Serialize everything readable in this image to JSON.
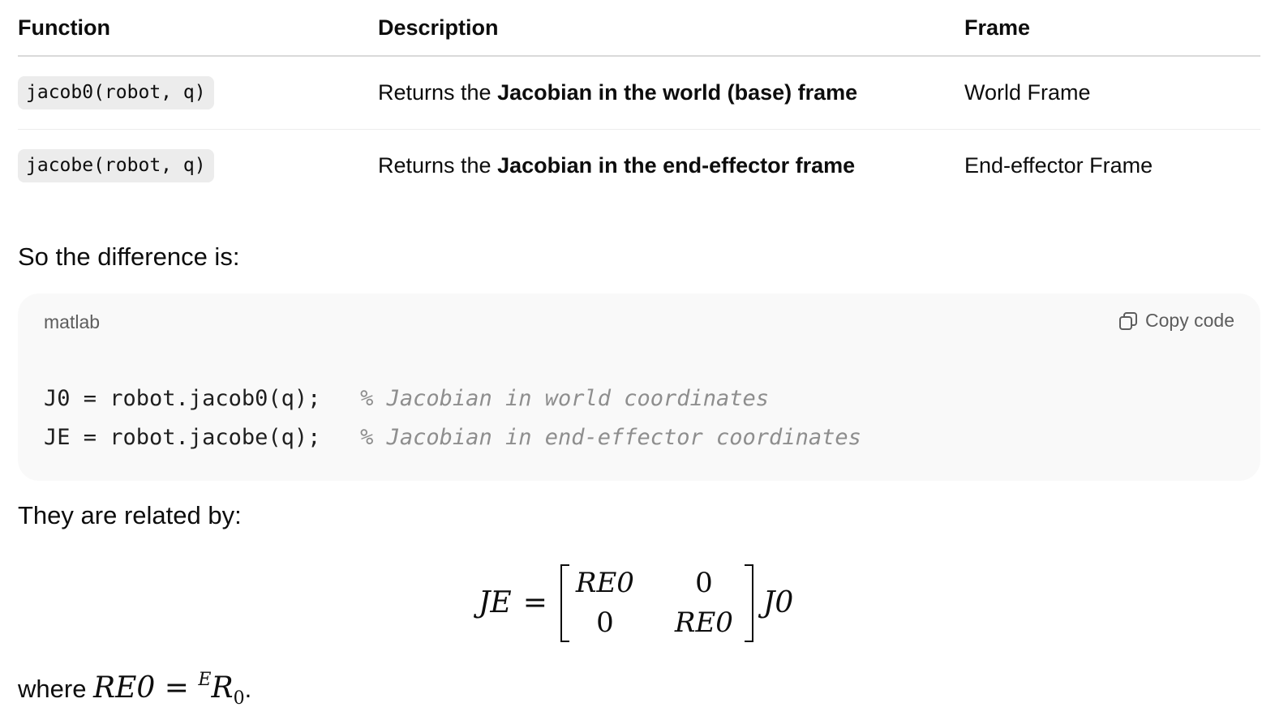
{
  "table": {
    "headers": [
      "Function",
      "Description",
      "Frame"
    ],
    "rows": [
      {
        "function": "jacob0(robot, q)",
        "desc_prefix": "Returns the ",
        "desc_bold": "Jacobian in the world (base) frame",
        "frame": "World Frame"
      },
      {
        "function": "jacobe(robot, q)",
        "desc_prefix": "Returns the ",
        "desc_bold": "Jacobian in the end-effector frame",
        "frame": "End-effector Frame"
      }
    ]
  },
  "intro_text": "So the difference is:",
  "code_block": {
    "language": "matlab",
    "copy_label": "Copy code",
    "copy_icon": "copy-icon",
    "lines": [
      {
        "code": "J0 = robot.jacob0(q);   ",
        "comment": "% Jacobian in world coordinates"
      },
      {
        "code": "JE = robot.jacobe(q);   ",
        "comment": "% Jacobian in end-effector coordinates"
      }
    ]
  },
  "relation_text": "They are related by:",
  "equation": {
    "lhs": "JE",
    "equals": "=",
    "matrix": [
      [
        "RE0",
        "0"
      ],
      [
        "0",
        "RE0"
      ]
    ],
    "rhs": "J0"
  },
  "where": {
    "prefix": "where ",
    "symbol": "RE0",
    "equals": " = ",
    "sup": "E",
    "base": "R",
    "sub": "0",
    "suffix": "."
  }
}
